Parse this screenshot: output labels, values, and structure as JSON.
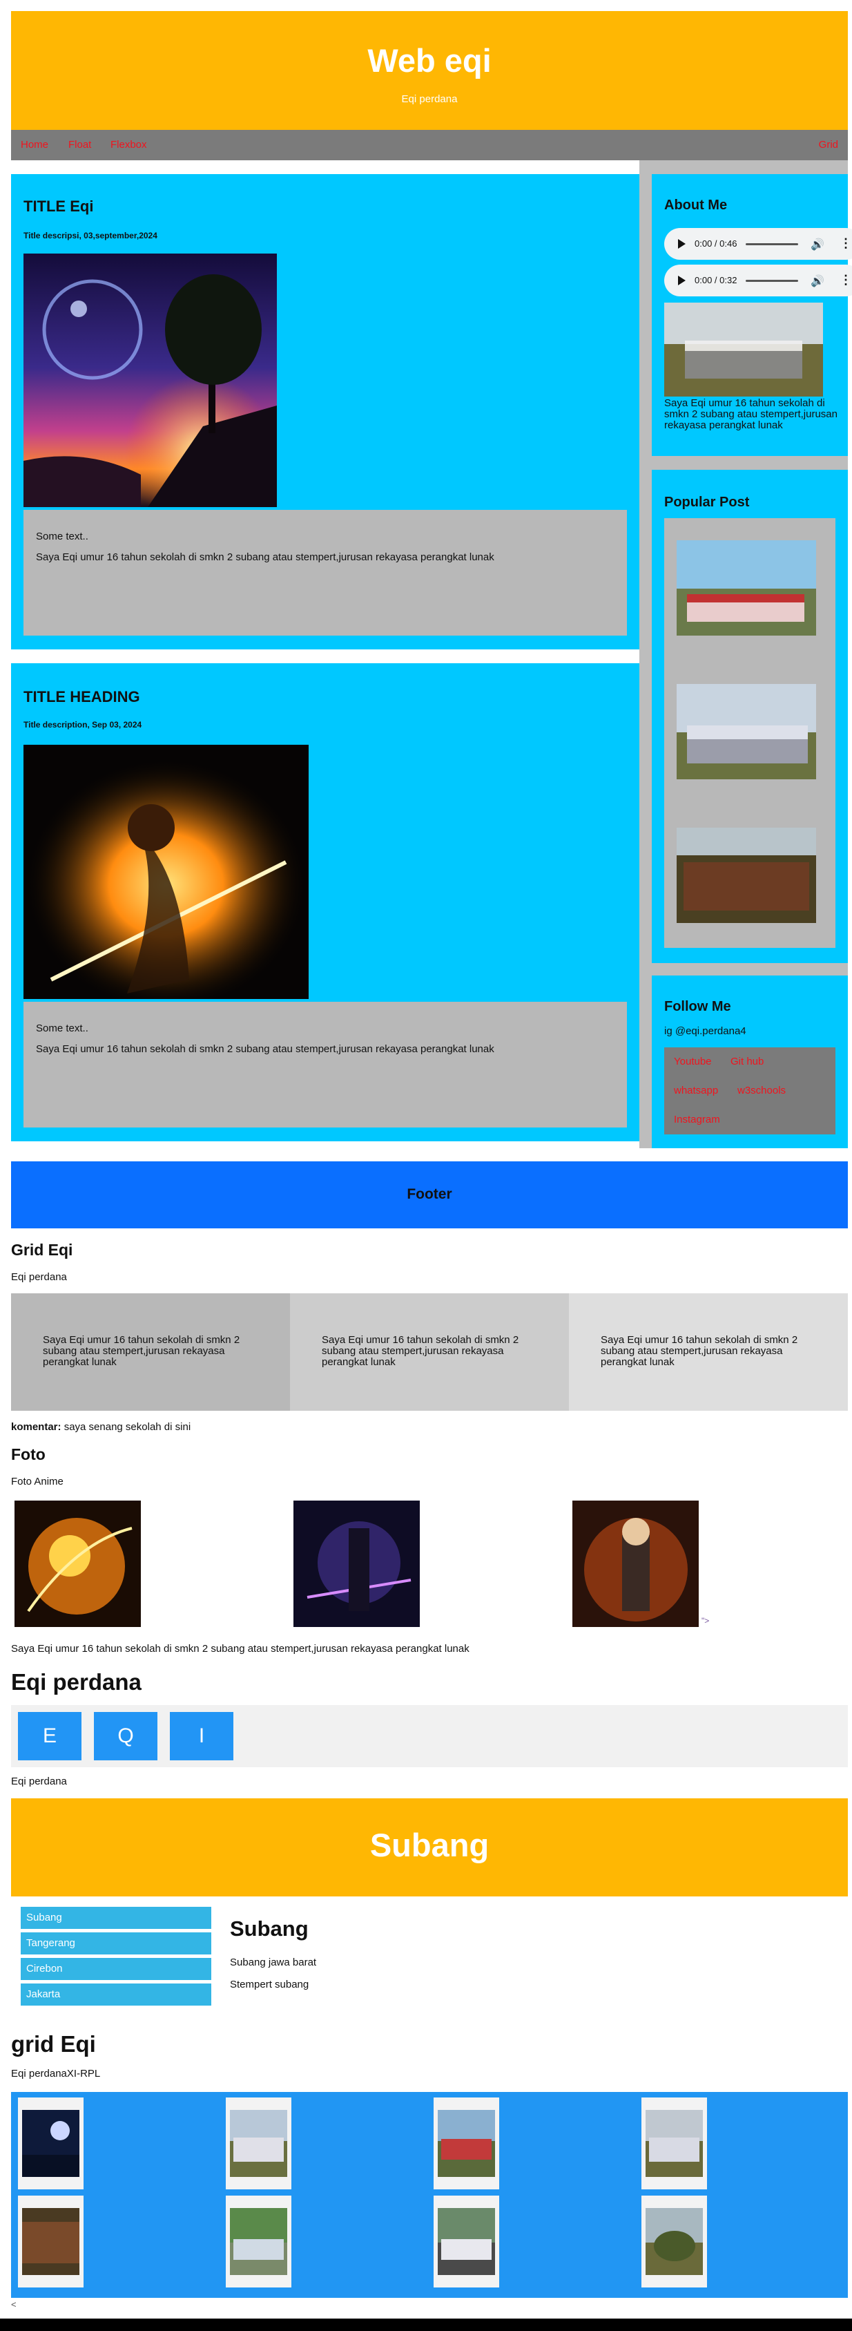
{
  "header": {
    "title": "Web eqi",
    "subtitle": "Eqi perdana"
  },
  "nav": {
    "home": "Home",
    "float": "Float",
    "flexbox": "Flexbox",
    "grid": "Grid"
  },
  "post1": {
    "title": "TITLE Eqi",
    "desc": "Title descripsi, 03,september,2024",
    "some_text": "Some text..",
    "body": "Saya Eqi umur 16 tahun sekolah di smkn 2 subang atau stempert,jurusan rekayasa perangkat lunak"
  },
  "post2": {
    "title": "TITLE HEADING",
    "desc": "Title description, Sep 03, 2024",
    "some_text": "Some text..",
    "body": "Saya Eqi umur 16 tahun sekolah di smkn 2 subang atau stempert,jurusan rekayasa perangkat lunak"
  },
  "about": {
    "title": "About Me",
    "audio1_time": "0:00 / 0:46",
    "audio2_time": "0:00 / 0:32",
    "text": "Saya Eqi umur 16 tahun sekolah di smkn 2 subang atau stempert,jurusan rekayasa perangkat lunak"
  },
  "popular": {
    "title": "Popular Post"
  },
  "follow": {
    "title": "Follow Me",
    "handle": "ig @eqi.perdana4",
    "links": [
      "Youtube",
      "Git hub",
      "whatsapp",
      "w3schools",
      "Instagram"
    ]
  },
  "footer": {
    "title": "Footer"
  },
  "grid_section": {
    "title": "Grid Eqi",
    "subtitle": "Eqi perdana",
    "cells": [
      "Saya Eqi umur 16 tahun sekolah di smkn 2 subang atau stempert,jurusan rekayasa perangkat lunak",
      "Saya Eqi umur 16 tahun sekolah di smkn 2 subang atau stempert,jurusan rekayasa perangkat lunak",
      "Saya Eqi umur 16 tahun sekolah di smkn 2 subang atau stempert,jurusan rekayasa perangkat lunak"
    ],
    "comment_label": "komentar:",
    "comment_text": " saya senang sekolah di sini"
  },
  "foto": {
    "title": "Foto",
    "subtitle": "Foto Anime",
    "stray": "\">",
    "caption": "Saya Eqi umur 16 tahun sekolah di smkn 2 subang atau stempert,jurusan rekayasa perangkat lunak"
  },
  "flex": {
    "title": "Eqi perdana",
    "letters": [
      "E",
      "Q",
      "I"
    ],
    "caption": "Eqi perdana"
  },
  "subang": {
    "banner": "Subang",
    "menu": [
      "Subang",
      "Tangerang",
      "Cirebon",
      "Jakarta"
    ],
    "heading": "Subang",
    "line1": "Subang jawa barat",
    "line2": "Stempert subang"
  },
  "grid2": {
    "title": "grid Eqi",
    "subtitle": "Eqi perdanaXI-RPL",
    "stray": "<"
  },
  "colors": {
    "header": "#ffb703",
    "nav": "#7b7b7b",
    "card": "#00c8ff",
    "footer": "#0a6fff",
    "link": "#f0141e",
    "flex_item": "#2295f5",
    "menu_item": "#33b5e5"
  }
}
